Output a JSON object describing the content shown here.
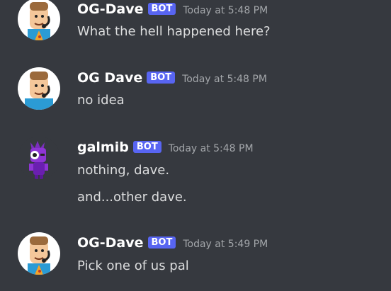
{
  "channel": {
    "messages": [
      {
        "author": "OG-Dave",
        "bot_tag": "BOT",
        "timestamp": "Today at 5:48 PM",
        "lines": [
          "What the hell happened here?"
        ],
        "avatar_icon": "dave-headset-avatar"
      },
      {
        "author": "OG Dave",
        "bot_tag": "BOT",
        "timestamp": "Today at 5:48 PM",
        "lines": [
          "no idea"
        ],
        "avatar_icon": "dave-headset-avatar"
      },
      {
        "author": "galmib",
        "bot_tag": "BOT",
        "timestamp": "Today at 5:48 PM",
        "lines": [
          "nothing, dave.",
          "and...other dave."
        ],
        "avatar_icon": "purple-character-avatar"
      },
      {
        "author": "OG-Dave",
        "bot_tag": "BOT",
        "timestamp": "Today at 5:49 PM",
        "lines": [
          "Pick one of us pal"
        ],
        "avatar_icon": "dave-headset-avatar"
      }
    ]
  },
  "colors": {
    "background": "#36393f",
    "bot_tag": "#5865f2",
    "username": "#ffffff",
    "message_text": "#dcddde",
    "timestamp": "#a3a6aa"
  }
}
